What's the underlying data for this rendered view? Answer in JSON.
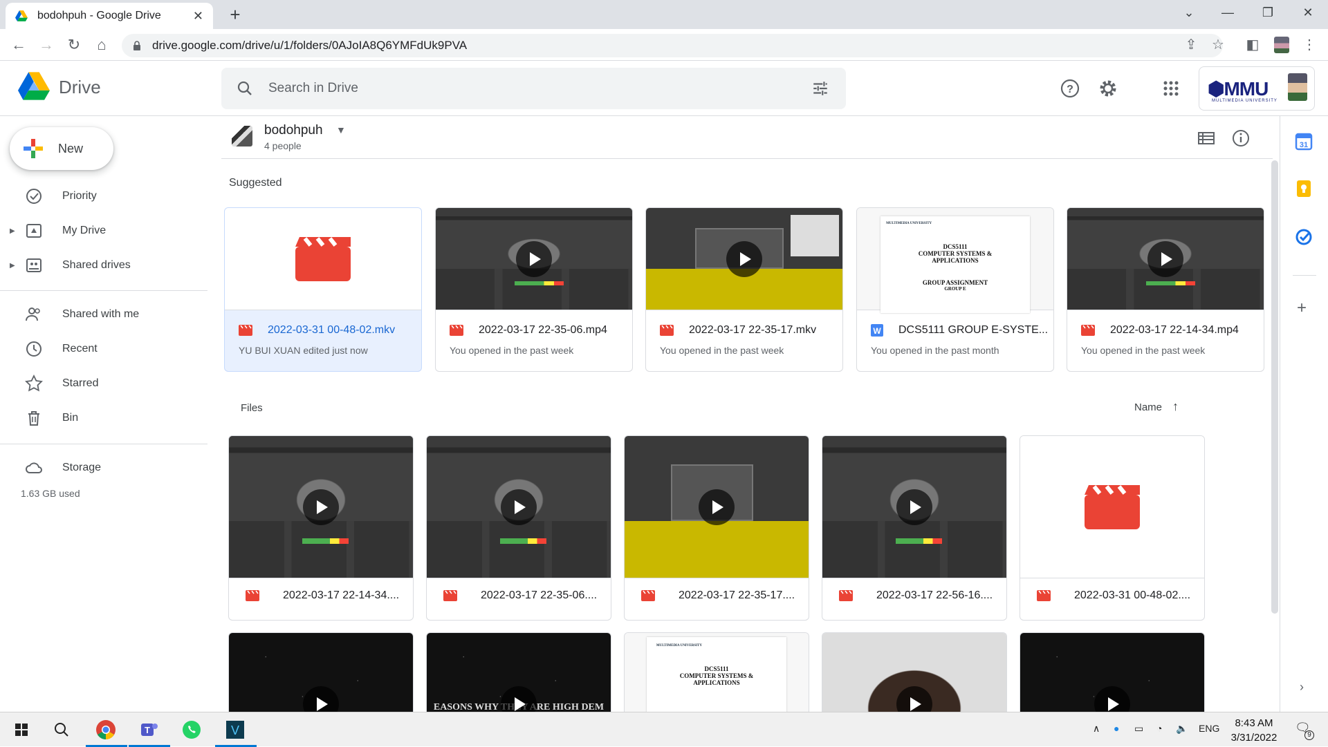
{
  "browser": {
    "tab_title": "bodohpuh - Google Drive",
    "url": "drive.google.com/drive/u/1/folders/0AJoIA8Q6YMFdUk9PVA"
  },
  "header": {
    "app_name": "Drive",
    "search_placeholder": "Search in Drive",
    "org_logo_text": "MMU",
    "org_logo_sub": "MULTIMEDIA UNIVERSITY"
  },
  "sidebar": {
    "new_label": "New",
    "items": [
      {
        "label": "Priority",
        "icon": "priority-icon"
      },
      {
        "label": "My Drive",
        "icon": "my-drive-icon"
      },
      {
        "label": "Shared drives",
        "icon": "shared-drives-icon"
      },
      {
        "label": "Shared with me",
        "icon": "shared-with-me-icon"
      },
      {
        "label": "Recent",
        "icon": "clock-icon"
      },
      {
        "label": "Starred",
        "icon": "star-icon"
      },
      {
        "label": "Bin",
        "icon": "bin-icon"
      },
      {
        "label": "Storage",
        "icon": "cloud-icon"
      }
    ],
    "storage_used": "1.63 GB used"
  },
  "folder": {
    "name": "bodohpuh",
    "members": "4 people"
  },
  "suggested": {
    "heading": "Suggested",
    "cards": [
      {
        "name": "2022-03-31 00-48-02.mkv",
        "sub": "YU BUI XUAN edited just now",
        "type": "video"
      },
      {
        "name": "2022-03-17 22-35-06.mp4",
        "sub": "You opened in the past week",
        "type": "video"
      },
      {
        "name": "2022-03-17 22-35-17.mkv",
        "sub": "You opened in the past week",
        "type": "video"
      },
      {
        "name": "DCS5111 GROUP E-SYSTE...",
        "sub": "You opened in the past month",
        "type": "word"
      },
      {
        "name": "2022-03-17 22-14-34.mp4",
        "sub": "You opened in the past week",
        "type": "video"
      }
    ]
  },
  "files": {
    "heading": "Files",
    "sort_label": "Name",
    "row1": [
      {
        "name": "2022-03-17 22-14-34...."
      },
      {
        "name": "2022-03-17 22-35-06...."
      },
      {
        "name": "2022-03-17 22-35-17...."
      },
      {
        "name": "2022-03-17 22-56-16...."
      },
      {
        "name": "2022-03-31 00-48-02...."
      }
    ],
    "row2_overlay_text": "EASONS WHY THEY ARE HIGH DEM"
  },
  "doc_thumb": {
    "university": "MULTIMEDIA UNIVERSITY",
    "course": "DCS5111",
    "title1": "COMPUTER SYSTEMS &",
    "title2": "APPLICATIONS",
    "group": "GROUP ASSIGNMENT",
    "group_letter": "GROUP E"
  },
  "taskbar": {
    "lang": "ENG",
    "time": "8:43 AM",
    "date": "3/31/2022",
    "notif_count": "9"
  }
}
